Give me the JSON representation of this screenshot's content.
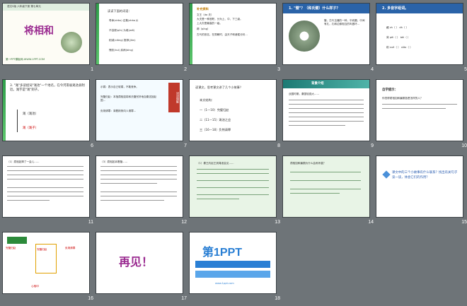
{
  "slides": [
    {
      "num": "1",
      "title": "将相和",
      "header": "语文S版  六年级下册  第七单元",
      "footer": "第一PPT模板网-WWW.1PPT.COM"
    },
    {
      "num": "2",
      "heading": "读读下面的词语：",
      "lines": [
        "寿命(shòu)  召集(zhào jí)",
        "不容侵(qīn)  为难(wéi)",
        "削减(xiǎng)  推荐(jiàn)",
        "愧疚(kuì)  疾病(bìng)"
      ]
    },
    {
      "num": "3",
      "heading": "补充资料",
      "lines": [
        "文王（da 夫）",
        "大夫是一种官职，分为上、中、下三级。",
        "上大夫是最高的一级。",
        "卿（qīng）",
        "蔺相如",
        "古代的官名，在周朝时，由天子和诸侯分封…"
      ]
    },
    {
      "num": "4",
      "heading": "1. \"璧\"？（和氏璧）什么样子？",
      "caption": "璧，古代玉器的一种，平而圆，中间有孔，孔和边缘相当的叫做环…"
    },
    {
      "num": "5",
      "heading": "2. 多音字组词。",
      "lines": [
        "藏 zh（ ）  dh（ ）",
        "背 pēi（ ）  bèi（ ）",
        "削 xuē（ ）  xiāo（ ）"
      ]
    },
    {
      "num": "6",
      "heading": "3. \"渑\"多读组词\"渑池\"一个地名，在今河南省渑池县附近。渑字是\"渑\"则子。",
      "items": [
        "渑（渑池）",
        "渑（渑子）"
      ]
    },
    {
      "num": "7",
      "tag": "词语理解",
      "lines": [
        "示弱：表示自己软弱，不敢竞争。",
        "完璧归赵：本指蔺相如将和氏璧完好地自秦送回赵国…",
        "负荆请罪：背着荆条向人请罪…"
      ]
    },
    {
      "num": "8",
      "heading": "读课文，思考课文讲了几个小故事？",
      "lines": [
        "本文结构：",
        "一（1—10）完璧归赵",
        "二（11—15）渑池之会",
        "三（16—18）负荆请罪"
      ]
    },
    {
      "num": "9",
      "heading": "背景介绍",
      "lines": [
        "战国时期，秦国较强大……"
      ]
    },
    {
      "num": "10",
      "heading": "自学提示：",
      "lines": [
        "你觉得蔺相如和廉颇各是怎样的人？"
      ]
    },
    {
      "num": "11",
      "lines": [
        "（1）蔺相如捧了一会儿……"
      ]
    },
    {
      "num": "12",
      "lines": [
        "（3）蔺相如拿着璧……"
      ]
    },
    {
      "num": "13",
      "lines": [
        "（1）秦王约赵王到渑池会见……"
      ]
    },
    {
      "num": "14",
      "lines": [
        "蔺相如和廉颇为什么会闹矛盾？"
      ]
    },
    {
      "num": "15",
      "lines": [
        "课文中的三个小故事有什么联系？找出有关句子读一读，体会它们的作用？"
      ]
    },
    {
      "num": "16",
      "boxes": [
        "完璧归赵",
        "渑池之会",
        "负荆请罪"
      ],
      "footer": "心相印",
      "center": "完璧归赵"
    },
    {
      "num": "17",
      "title": "再见！"
    },
    {
      "num": "18",
      "logo": "第1PPT",
      "sub": "www.1ppt.com"
    }
  ]
}
